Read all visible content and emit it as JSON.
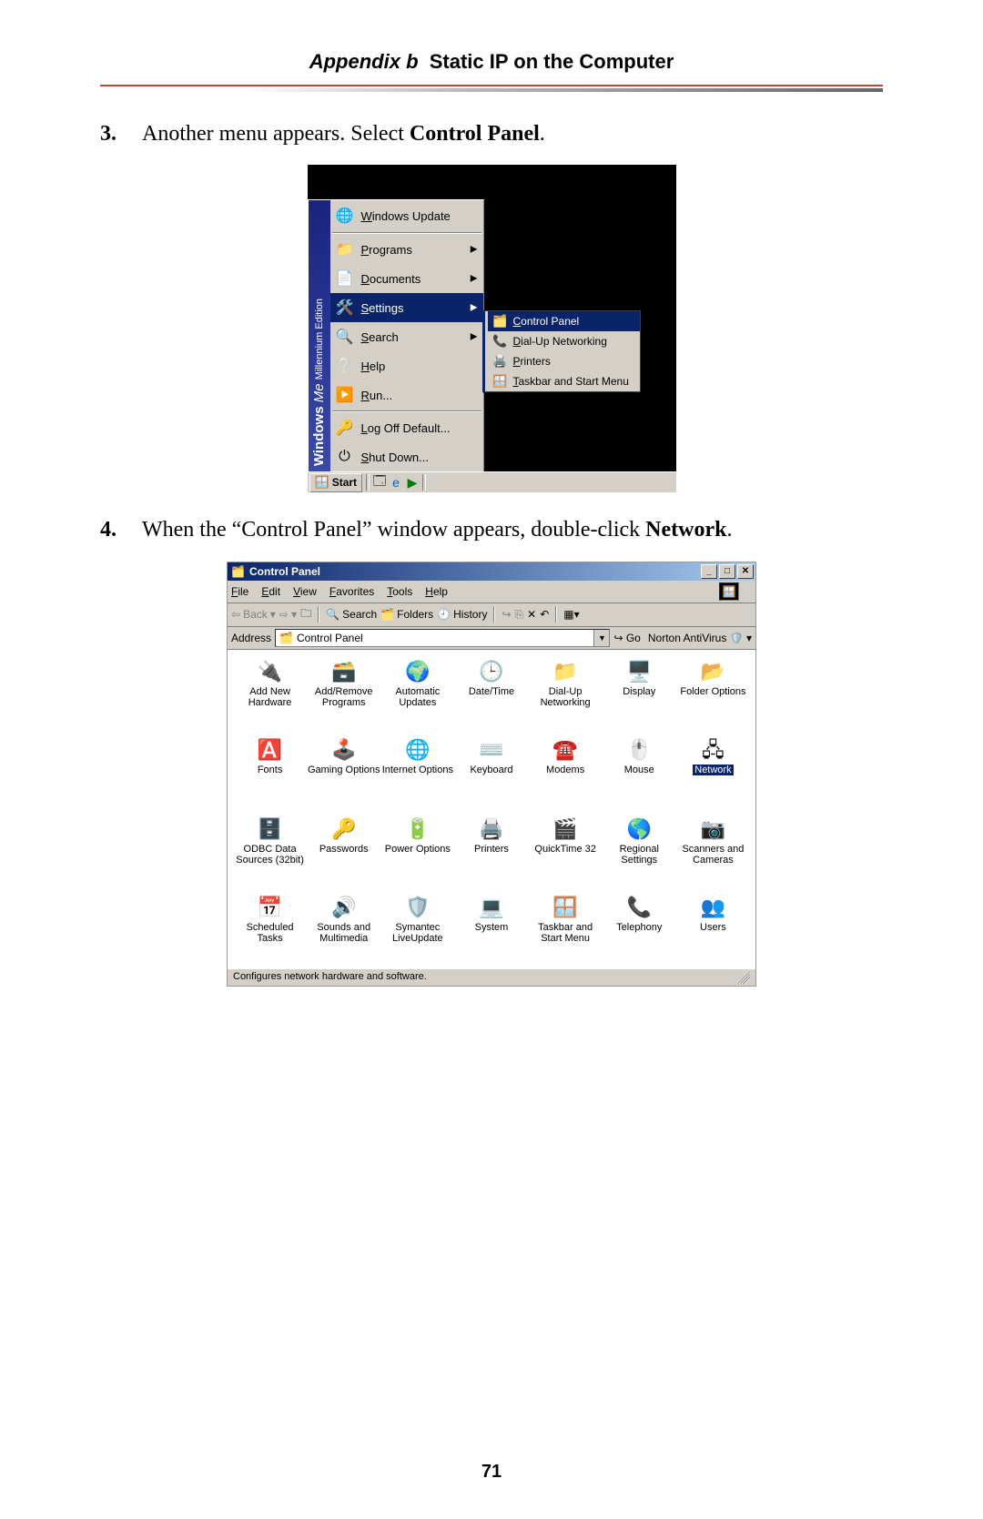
{
  "header": {
    "appendix": "Appendix b",
    "title": "Static IP on the Computer"
  },
  "step3": {
    "num": "3.",
    "pre": "Another menu appears. Select ",
    "bold": "Control Panel",
    "post": "."
  },
  "step4": {
    "num": "4.",
    "pre": "When the “Control Panel” window appears, double-click ",
    "bold": "Network",
    "post": "."
  },
  "pageNumber": "71",
  "startmenu": {
    "sidebar_text_a": "Windows",
    "sidebar_text_b": "Me",
    "sidebar_text_c": "Millennium Edition",
    "items": [
      {
        "label": "Windows Update",
        "icon": "🌐",
        "arrow": false
      },
      {
        "label": "Programs",
        "icon": "📁",
        "arrow": true
      },
      {
        "label": "Documents",
        "icon": "📄",
        "arrow": true
      },
      {
        "label": "Settings",
        "icon": "🛠️",
        "arrow": true,
        "selected": true
      },
      {
        "label": "Search",
        "icon": "🔍",
        "arrow": true
      },
      {
        "label": "Help",
        "icon": "❔",
        "arrow": false
      },
      {
        "label": "Run...",
        "icon": "▶️",
        "arrow": false
      },
      {
        "label": "Log Off Default...",
        "icon": "🔑",
        "arrow": false
      },
      {
        "label": "Shut Down...",
        "icon": "⏻",
        "arrow": false
      }
    ],
    "submenu": [
      {
        "label": "Control Panel",
        "icon": "🗂️",
        "selected": true
      },
      {
        "label": "Dial-Up Networking",
        "icon": "📞"
      },
      {
        "label": "Printers",
        "icon": "🖨️"
      },
      {
        "label": "Taskbar and Start Menu",
        "icon": "🪟"
      }
    ],
    "taskbar": {
      "start": "Start"
    }
  },
  "cpwin": {
    "title": "Control Panel",
    "menus": [
      "File",
      "Edit",
      "View",
      "Favorites",
      "Tools",
      "Help"
    ],
    "toolbar": {
      "back": "Back",
      "search": "Search",
      "folders": "Folders",
      "history": "History"
    },
    "address_label": "Address",
    "address_value": "Control Panel",
    "go": "Go",
    "norton": "Norton AntiVirus",
    "status": "Configures network hardware and software.",
    "icons": [
      {
        "label": "Add New Hardware",
        "glyph": "🔌"
      },
      {
        "label": "Add/Remove Programs",
        "glyph": "🗃️"
      },
      {
        "label": "Automatic Updates",
        "glyph": "🌍"
      },
      {
        "label": "Date/Time",
        "glyph": "🕒"
      },
      {
        "label": "Dial-Up Networking",
        "glyph": "📁"
      },
      {
        "label": "Display",
        "glyph": "🖥️"
      },
      {
        "label": "Folder Options",
        "glyph": "📂"
      },
      {
        "label": "Fonts",
        "glyph": "🅰️"
      },
      {
        "label": "Gaming Options",
        "glyph": "🕹️"
      },
      {
        "label": "Internet Options",
        "glyph": "🌐"
      },
      {
        "label": "Keyboard",
        "glyph": "⌨️"
      },
      {
        "label": "Modems",
        "glyph": "☎️"
      },
      {
        "label": "Mouse",
        "glyph": "🖱️"
      },
      {
        "label": "Network",
        "glyph": "🖧",
        "selected": true
      },
      {
        "label": "ODBC Data Sources (32bit)",
        "glyph": "🗄️"
      },
      {
        "label": "Passwords",
        "glyph": "🔑"
      },
      {
        "label": "Power Options",
        "glyph": "🔋"
      },
      {
        "label": "Printers",
        "glyph": "🖨️"
      },
      {
        "label": "QuickTime 32",
        "glyph": "🎬"
      },
      {
        "label": "Regional Settings",
        "glyph": "🌎"
      },
      {
        "label": "Scanners and Cameras",
        "glyph": "📷"
      },
      {
        "label": "Scheduled Tasks",
        "glyph": "📅"
      },
      {
        "label": "Sounds and Multimedia",
        "glyph": "🔊"
      },
      {
        "label": "Symantec LiveUpdate",
        "glyph": "🛡️"
      },
      {
        "label": "System",
        "glyph": "💻"
      },
      {
        "label": "Taskbar and Start Menu",
        "glyph": "🪟"
      },
      {
        "label": "Telephony",
        "glyph": "📞"
      },
      {
        "label": "Users",
        "glyph": "👥"
      }
    ]
  }
}
